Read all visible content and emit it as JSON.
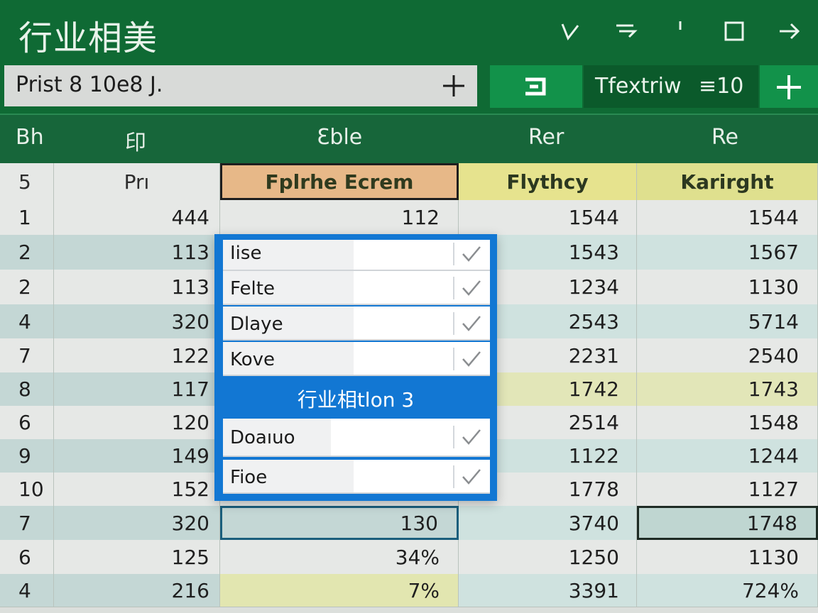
{
  "app": {
    "title": "行业相美"
  },
  "window_controls": [
    "minimize-icon",
    "restore-icon",
    "divider-icon",
    "maximize-icon",
    "forward-arrow-icon"
  ],
  "toolbar": {
    "name_box": "Prist 8 10e8 J.",
    "font_name": "Tfextriw",
    "font_size": "≡10"
  },
  "columns": {
    "c0": "Bh",
    "c1": "印",
    "c2": "Ɛble",
    "c3": "Rer",
    "c4": "Re"
  },
  "header_row": [
    "5",
    "Prı",
    "Fplrhe Ecrem",
    "Flythcy",
    "Karirght"
  ],
  "rows": [
    [
      "1",
      "444",
      "112",
      "1544",
      "1544"
    ],
    [
      "2",
      "113",
      "",
      "1543",
      "1567"
    ],
    [
      "2",
      "113",
      "",
      "1234",
      "1130"
    ],
    [
      "4",
      "320",
      "",
      "2543",
      "5714"
    ],
    [
      "7",
      "122",
      "",
      "2231",
      "2540"
    ],
    [
      "8",
      "117",
      "",
      "1742",
      "1743"
    ],
    [
      "6",
      "120",
      "",
      "2514",
      "1548"
    ],
    [
      "9",
      "149",
      "",
      "1122",
      "1244"
    ],
    [
      "10",
      "152",
      "",
      "1778",
      "1127"
    ],
    [
      "7",
      "320",
      "130",
      "3740",
      "1748"
    ],
    [
      "6",
      "125",
      "34%",
      "1250",
      "1130"
    ],
    [
      "4",
      "216",
      "7%",
      "3391",
      "724%"
    ]
  ],
  "dropdown": {
    "items": [
      "Iise",
      "Felte",
      "Dlaye",
      "Kove"
    ],
    "section_label": "行业相tlon 3",
    "items_after": [
      "Doaıuo",
      "Fioe"
    ]
  },
  "colors": {
    "accent_green": "#0f6a34",
    "selection_blue": "#1277d3"
  }
}
